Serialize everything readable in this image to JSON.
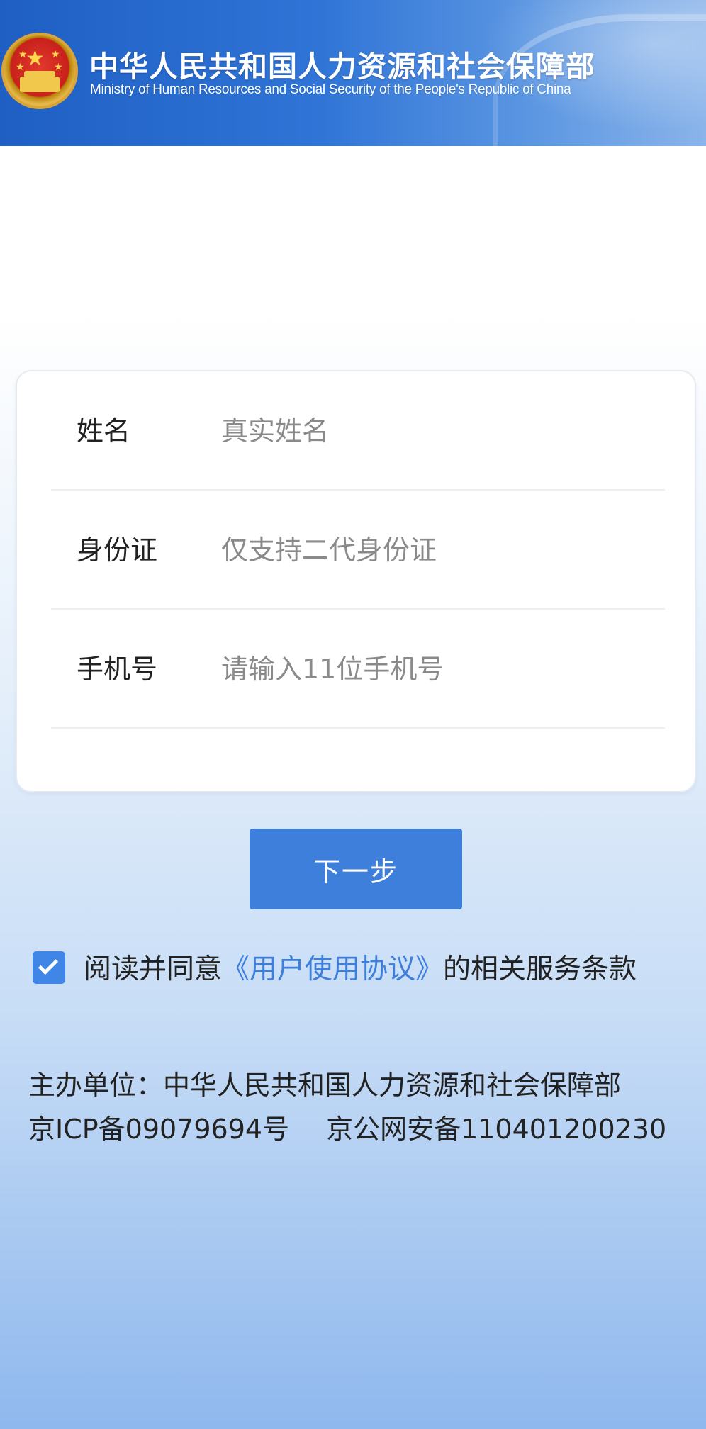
{
  "header": {
    "title": "中华人民共和国人力资源和社会保障部",
    "subtitle": "Ministry of Human Resources and Social Security of the People's Republic of China",
    "emblem_icon": "national-emblem-icon",
    "colors": {
      "banner": "#2f74d6"
    }
  },
  "form": {
    "fields": [
      {
        "label": "姓名",
        "placeholder": "真实姓名",
        "value": ""
      },
      {
        "label": "身份证",
        "placeholder": "仅支持二代身份证",
        "value": ""
      },
      {
        "label": "手机号",
        "placeholder": "请输入11位手机号",
        "value": ""
      }
    ]
  },
  "next_button": {
    "label": "下一步",
    "color": "#3f7fdc"
  },
  "agreement": {
    "checked": true,
    "prefix": "阅读并同意",
    "link": "《用户使用协议》",
    "suffix": "的相关服务条款"
  },
  "footer": {
    "organizer": "主办单位：中华人民共和国人力资源和社会保障部",
    "icp": "京ICP备09079694号",
    "police": "京公网安备110401200230"
  }
}
